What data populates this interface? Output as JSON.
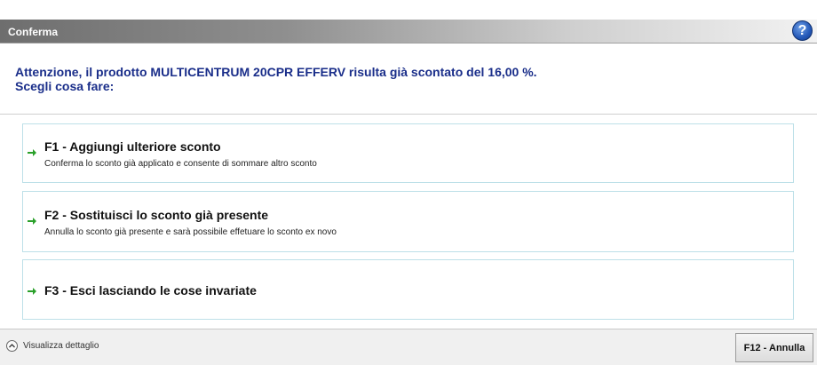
{
  "window": {
    "title": "Conferma",
    "help_glyph": "?"
  },
  "message": {
    "line1": "Attenzione, il prodotto MULTICENTRUM 20CPR EFFERV risulta già scontato del 16,00 %.",
    "line2": "Scegli cosa fare:"
  },
  "options": [
    {
      "title": "F1 - Aggiungi ulteriore sconto",
      "description": "Conferma lo sconto già applicato e consente di sommare altro sconto",
      "icon": "green-arrow-right-icon"
    },
    {
      "title": "F2 - Sostituisci lo sconto già presente",
      "description": "Annulla lo sconto già presente e sarà possibile effetuare lo sconto ex novo",
      "icon": "green-arrow-right-icon"
    },
    {
      "title": "F3 - Esci lasciando le cose invariate",
      "icon": "green-arrow-right-icon"
    }
  ],
  "footer": {
    "details_label": "Visualizza dettaglio",
    "cancel_label": "F12 - Annulla"
  },
  "colors": {
    "message_text": "#1a2e8a",
    "option_border": "#bde0e8",
    "arrow": "#2aa02a"
  }
}
